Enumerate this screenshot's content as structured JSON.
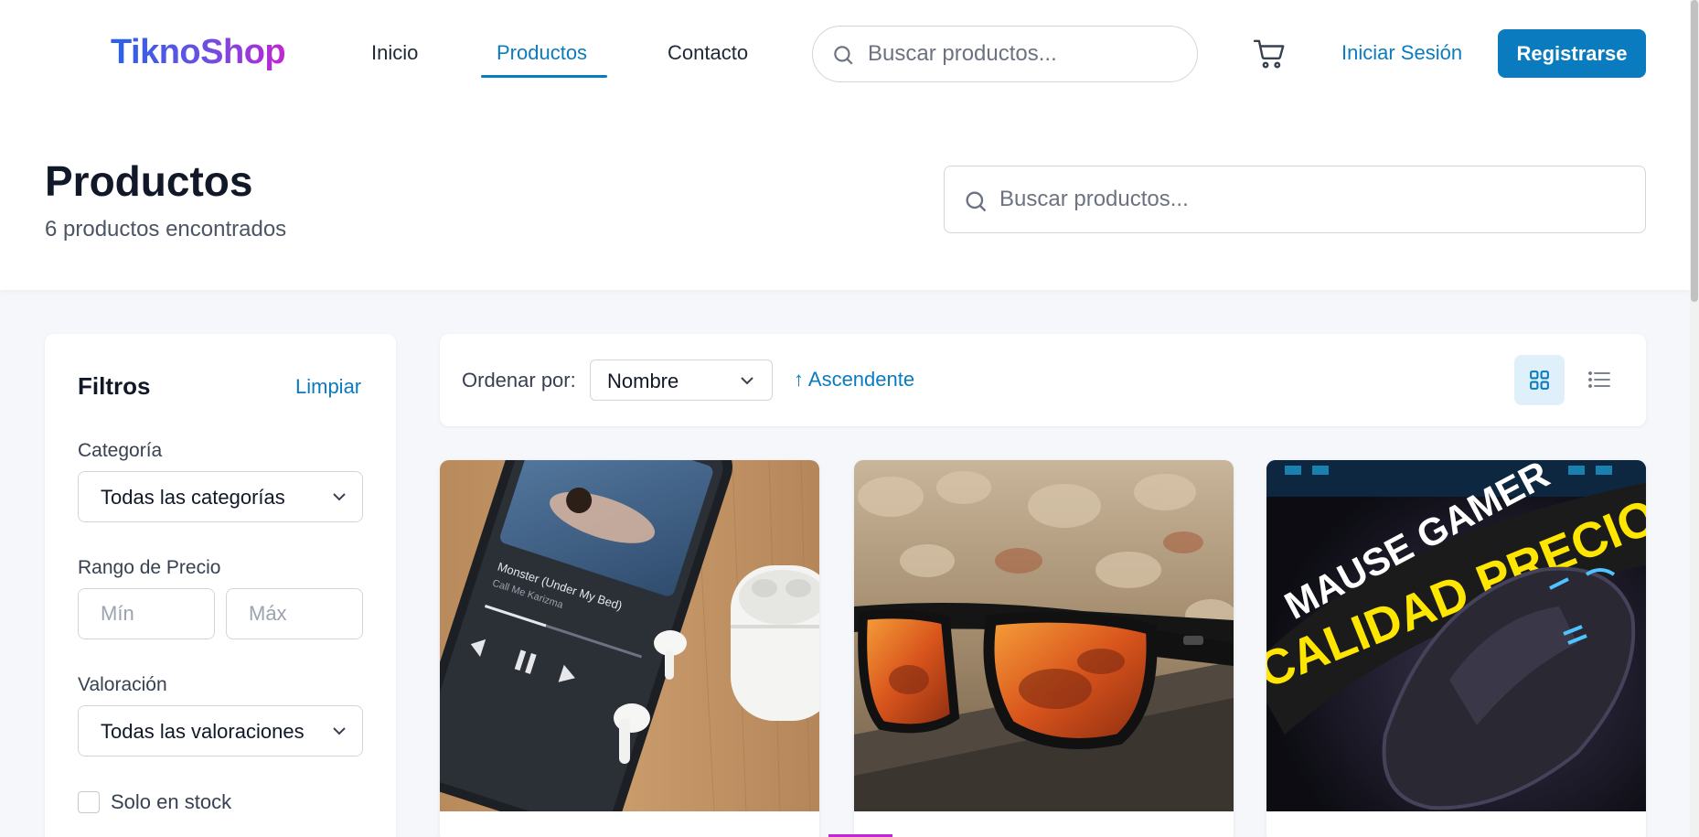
{
  "header": {
    "logo": "TiknoShop",
    "nav": [
      {
        "label": "Inicio"
      },
      {
        "label": "Productos",
        "active": true
      },
      {
        "label": "Contacto"
      }
    ],
    "search_placeholder": "Buscar productos...",
    "cart_icon": "cart-icon",
    "login_label": "Iniciar Sesión",
    "register_label": "Registrarse"
  },
  "page": {
    "title": "Productos",
    "count_text": "6 productos encontrados",
    "search_placeholder": "Buscar productos..."
  },
  "filters": {
    "title": "Filtros",
    "clear_label": "Limpiar",
    "category_label": "Categoría",
    "category_value": "Todas las categorías",
    "price_label": "Rango de Precio",
    "price_min_placeholder": "Mín",
    "price_max_placeholder": "Máx",
    "rating_label": "Valoración",
    "rating_value": "Todas las valoraciones",
    "in_stock_label": "Solo en stock",
    "in_stock_checked": false
  },
  "toolbar": {
    "sort_label": "Ordenar por:",
    "sort_value": "Nombre",
    "sort_direction": "↑ Ascendente",
    "view_mode": "grid"
  },
  "products": [
    {
      "image": "phone-and-earbuds-photo",
      "image_text": [
        "Monster (Under My Bed)",
        "Call Me Karizma"
      ]
    },
    {
      "image": "sunglasses-photo"
    },
    {
      "image": "gaming-mouse-photo",
      "image_text": [
        "MAUSE GAMER",
        "CALIDAD PRECIO"
      ]
    }
  ],
  "colors": {
    "accent": "#0b7bbf",
    "logo_gradient": [
      "#2563eb",
      "#c026d3"
    ],
    "background": "#f5f7fa"
  }
}
